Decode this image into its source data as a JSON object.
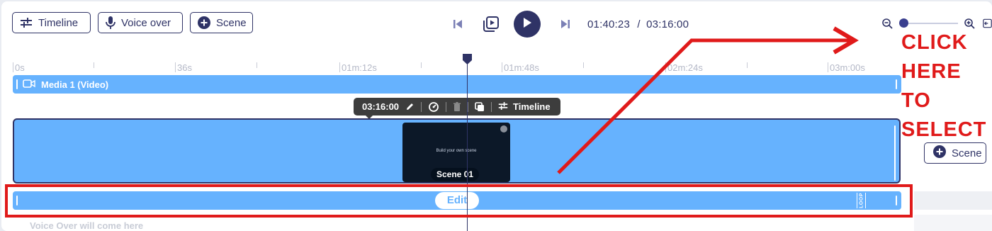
{
  "toolbar": {
    "timeline_label": "Timeline",
    "voiceover_label": "Voice over",
    "scene_label": "Scene"
  },
  "player": {
    "current_time": "01:40:23",
    "separator": "/",
    "total_time": "03:16:00"
  },
  "zoom": {
    "level": 0.0
  },
  "ruler": {
    "labels": [
      "0s",
      "36s",
      "01m:12s",
      "01m:48s",
      "02m:24s",
      "03m:00s"
    ]
  },
  "media_track": {
    "label": "Media 1 (Video)"
  },
  "tooltip": {
    "duration": "03:16:00",
    "timeline_label": "Timeline"
  },
  "scene": {
    "thumbnail_text": "Build your own scene",
    "label": "Scene 01",
    "add_label": "Scene"
  },
  "edit_track": {
    "edit_label": "Edit",
    "loop_label": "LOOP"
  },
  "voiceover_track": {
    "placeholder": "Voice Over will come here"
  },
  "annotation": {
    "lines": [
      "CLICK",
      "HERE",
      "TO",
      "SELECT"
    ]
  },
  "colors": {
    "accent": "#2f3366",
    "track": "#66b2fe",
    "annotation": "#e01a1a"
  }
}
